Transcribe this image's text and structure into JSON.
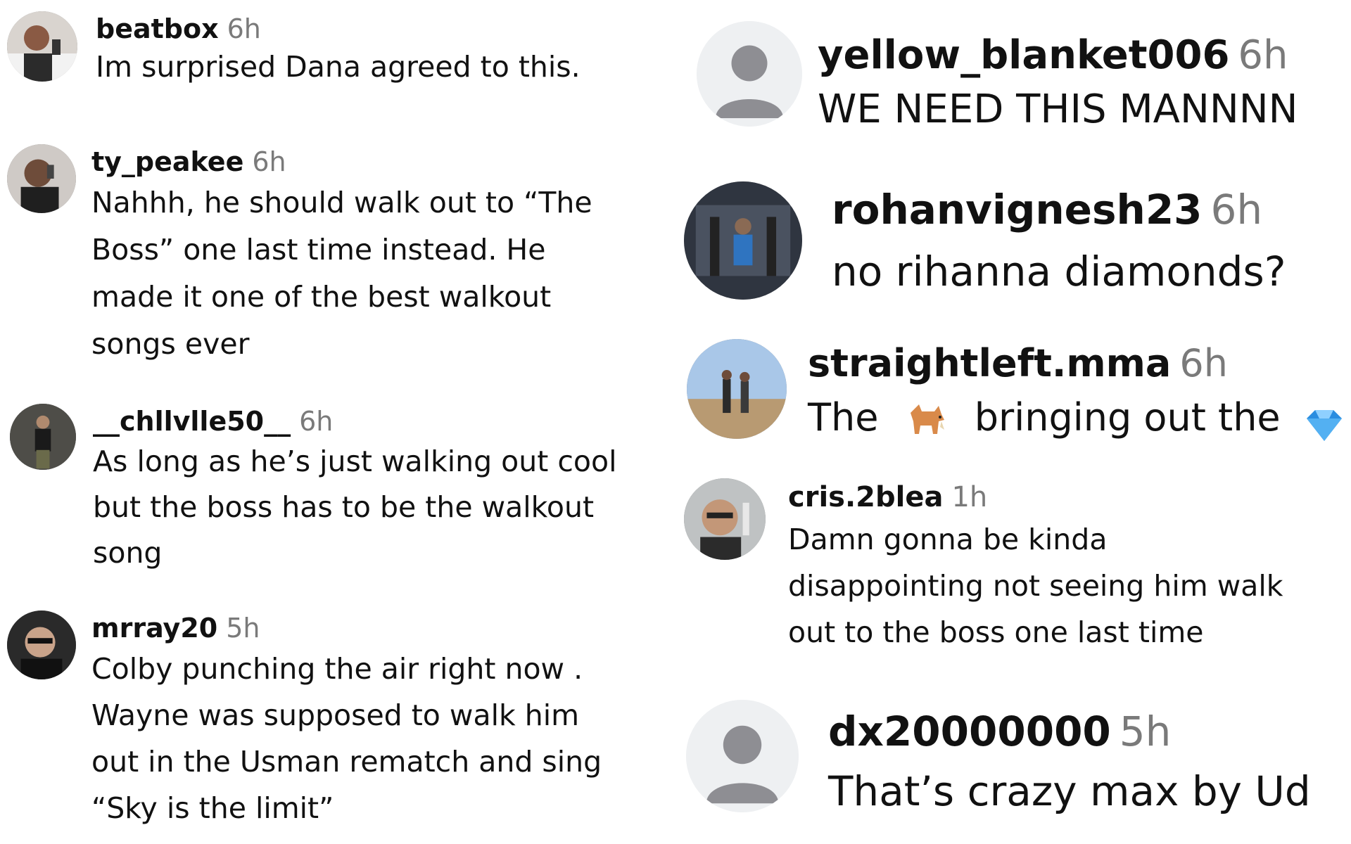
{
  "comments_left": [
    {
      "username": "beatbox",
      "time": "6h",
      "lines": [
        "Im surprised Dana agreed to this."
      ],
      "avatar_icon": "user-photo-icon"
    },
    {
      "username": "ty_peakee",
      "time": "6h",
      "lines": [
        "Nahhh, he should walk out to “The",
        "Boss” one last time instead. He",
        "made it one of the best walkout",
        "songs ever"
      ],
      "avatar_icon": "user-photo-icon"
    },
    {
      "username": "__chllvlle50__",
      "time": "6h",
      "lines": [
        "As long as he’s just walking out cool",
        "but the boss has to be the walkout",
        "song"
      ],
      "avatar_icon": "user-photo-icon"
    },
    {
      "username": "mrray20",
      "time": "5h",
      "lines": [
        "Colby punching the air right now .",
        "Wayne was supposed to walk him",
        "out in the Usman rematch and sing",
        "“Sky is the limit”"
      ],
      "avatar_icon": "user-photo-icon"
    }
  ],
  "comments_right": [
    {
      "username": "yellow_blanket006",
      "time": "6h",
      "lines": [
        "WE NEED THIS MANNNN"
      ],
      "avatar_icon": "default-avatar-icon"
    },
    {
      "username": "rohanvignesh23",
      "time": "6h",
      "lines": [
        "no rihanna diamonds?"
      ],
      "avatar_icon": "user-photo-icon"
    },
    {
      "username": "straightleft.mma",
      "time": "6h",
      "lines": [
        "The",
        "bringing out the"
      ],
      "emojis": [
        "goat-emoji-icon",
        "gem-emoji-icon"
      ],
      "avatar_icon": "user-photo-icon"
    },
    {
      "username": "cris.2blea",
      "time": "1h",
      "lines": [
        "Damn gonna be kinda",
        "disappointing not seeing him walk",
        "out to the boss one last time"
      ],
      "avatar_icon": "user-photo-icon"
    },
    {
      "username": "dx20000000",
      "time": "5h",
      "lines": [
        "That’s crazy max by Ud"
      ],
      "avatar_icon": "default-avatar-icon"
    }
  ],
  "colors": {
    "username": "#111111",
    "timestamp": "#7a7a7a",
    "default_avatar_bg": "#eef0f2",
    "default_avatar_fg": "#8e8e93"
  }
}
